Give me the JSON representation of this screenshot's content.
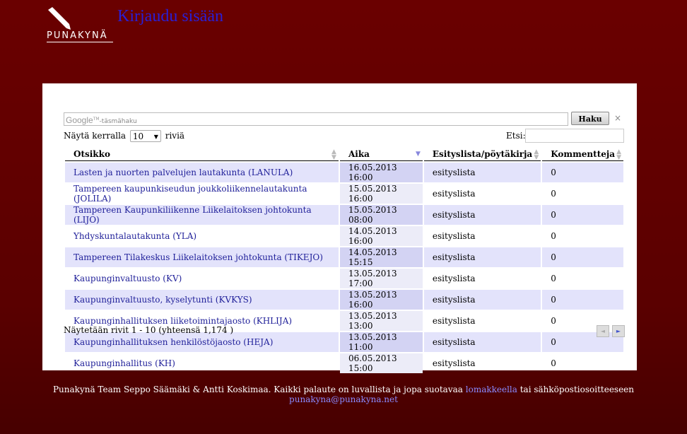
{
  "header": {
    "logo_text": "PUNAKYNÄ",
    "login_label": "Kirjaudu sisään"
  },
  "search": {
    "google_label": "Google",
    "google_tm": "TM",
    "placeholder": "-täsmähaku",
    "button_label": "Haku",
    "clear_label": "×"
  },
  "table_controls": {
    "length_prefix": "Näytä kerralla",
    "length_value": "10",
    "length_suffix": "riviä",
    "filter_label": "Etsi:"
  },
  "table": {
    "columns": [
      "Otsikko",
      "Aika",
      "Esityslista/pöytäkirja",
      "Kommentteja"
    ],
    "rows": [
      [
        "Lasten ja nuorten palvelujen lautakunta (LANULA)",
        "16.05.2013 16:00",
        "esityslista",
        "0"
      ],
      [
        "Tampereen kaupunkiseudun joukkoliikennelautakunta (JOLILA)",
        "15.05.2013 16:00",
        "esityslista",
        "0"
      ],
      [
        "Tampereen Kaupunkiliikenne Liikelaitoksen johtokunta (LIJO)",
        "15.05.2013 08:00",
        "esityslista",
        "0"
      ],
      [
        "Yhdyskuntalautakunta (YLA)",
        "14.05.2013 16:00",
        "esityslista",
        "0"
      ],
      [
        "Tampereen Tilakeskus Liikelaitoksen johtokunta (TIKEJO)",
        "14.05.2013 15:15",
        "esityslista",
        "0"
      ],
      [
        "Kaupunginvaltuusto (KV)",
        "13.05.2013 17:00",
        "esityslista",
        "0"
      ],
      [
        "Kaupunginvaltuusto, kyselytunti (KVKYS)",
        "13.05.2013 16:00",
        "esityslista",
        "0"
      ],
      [
        "Kaupunginhallituksen liiketoimintajaosto (KHLIJA)",
        "13.05.2013 13:00",
        "esityslista",
        "0"
      ],
      [
        "Kaupunginhallituksen henkilöstöjaosto (HEJA)",
        "13.05.2013 11:00",
        "esityslista",
        "0"
      ],
      [
        "Kaupunginhallitus (KH)",
        "06.05.2013 15:00",
        "esityslista",
        "0"
      ]
    ],
    "info": "Näytetään rivit 1 - 10 (yhteensä 1,174 )",
    "prev_icon": "◄",
    "next_icon": "►"
  },
  "footer": {
    "text_before": "Punakynä Team Seppo Säämäki & Antti Koskimaa. Kaikki palaute on luvallista ja jopa suotavaa ",
    "form_link": "lomakkeella",
    "text_middle": " tai sähköpostiosoitteeseen ",
    "email_link": "punakyna@punakyna.net"
  },
  "colors": {
    "background": "#5e0000",
    "link": "#2a1fd6",
    "row_odd": "#e3e3fb",
    "footer_link": "#8a8aff"
  }
}
